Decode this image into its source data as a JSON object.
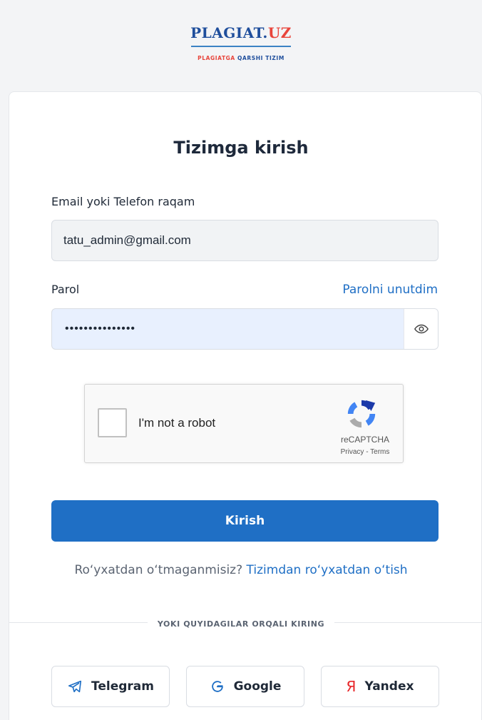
{
  "brand": {
    "name_main": "PLAGIAT.",
    "name_accent": "UZ",
    "tagline_part1": "PLAGIATGA ",
    "tagline_part2": "QARSHI TIZIM"
  },
  "login": {
    "title": "Tizimga kirish",
    "email_label": "Email yoki Telefon raqam",
    "email_value": "tatu_admin@gmail.com",
    "password_label": "Parol",
    "password_value": "•••••••••••••••",
    "forgot_link": "Parolni unutdim",
    "submit_label": "Kirish"
  },
  "captcha": {
    "label": "I'm not a robot",
    "brand": "reCAPTCHA",
    "links": "Privacy - Terms"
  },
  "register": {
    "question": "Ro‘yxatdan o‘tmaganmisiz?",
    "link": "Tizimdan ro‘yxatdan o‘tish"
  },
  "social": {
    "divider": "YOKI QUYIDAGILAR ORQALI KIRING",
    "telegram": "Telegram",
    "google": "Google",
    "yandex": "Yandex",
    "yandex_glyph": "Я"
  },
  "icons": {
    "eye": "eye-icon",
    "telegram": "telegram-icon",
    "google": "google-icon",
    "yandex": "yandex-icon",
    "recaptcha": "recaptcha-icon"
  },
  "colors": {
    "primary": "#1f6fc5",
    "brand_blue": "#1f4e9c",
    "brand_red": "#e8453c"
  }
}
